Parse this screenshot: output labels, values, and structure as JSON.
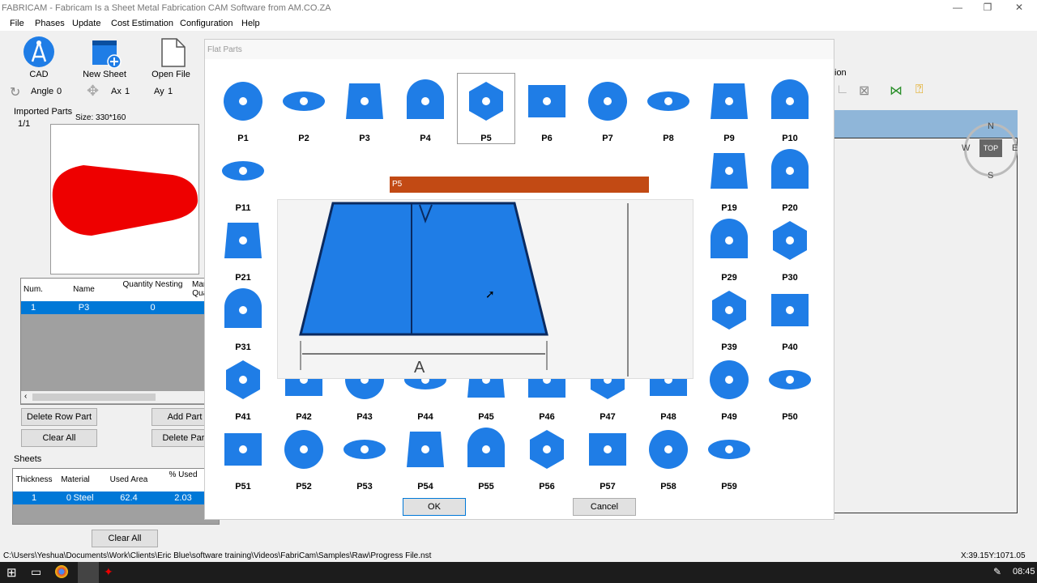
{
  "app": {
    "title": "FABRICAM - Fabricam Is a Sheet Metal Fabrication CAM Software from AM.CO.ZA",
    "minimize": "—",
    "maximize": "❐",
    "close": "✕"
  },
  "menu": [
    "File",
    "Phases",
    "Update",
    "Cost Estimation",
    "Configuration",
    "Help"
  ],
  "toolbar": {
    "cad": "CAD",
    "new_sheet": "New Sheet",
    "open_file": "Open File"
  },
  "controls": {
    "angle_label": "Angle",
    "angle_value": "0",
    "ax_label": "Ax",
    "ax_value": "1",
    "ay_label": "Ay",
    "ay_value": "1"
  },
  "imported": {
    "title": "Imported Parts",
    "page": "1/1",
    "size": "Size: 330*160",
    "columns": [
      "Num.",
      "Name",
      "Quantity Nesting",
      "Manu Quan"
    ],
    "rows": [
      {
        "num": "1",
        "name": "P3",
        "qty": "0",
        "manu": ""
      }
    ],
    "delete_row": "Delete Row Part",
    "add_part": "Add Part",
    "clear_all": "Clear All",
    "delete_part": "Delete Part"
  },
  "sheets": {
    "title": "Sheets",
    "columns": [
      "Thickness",
      "Material",
      "Used Area",
      "% Used"
    ],
    "rows": [
      {
        "thickness": "1",
        "mat_id": "0",
        "material": "Steel",
        "area": "62.4",
        "used": "2.03"
      }
    ],
    "clear_all": "Clear All"
  },
  "viewport": {
    "label_fragment": "ion",
    "compass": {
      "n": "N",
      "s": "S",
      "e": "E",
      "w": "W",
      "top": "TOP"
    }
  },
  "dialog": {
    "title": "Flat Parts",
    "ok": "OK",
    "cancel": "Cancel",
    "preview_title": "P5",
    "preview_dim": "A",
    "row_labels": [
      [
        "P1",
        "P2",
        "P3",
        "P4",
        "P5",
        "P6",
        "P7",
        "P8",
        "P9",
        "P10"
      ],
      [
        "P11",
        "P19",
        "P20"
      ],
      [
        "P21",
        "P29",
        "P30"
      ],
      [
        "P31",
        "P39",
        "P40"
      ],
      [
        "P41",
        "P42",
        "P43",
        "P44",
        "P45",
        "P46",
        "P47",
        "P48",
        "P49",
        "P50"
      ],
      [
        "P51",
        "P52",
        "P53",
        "P54",
        "P55",
        "P56",
        "P57",
        "P58",
        "P59"
      ]
    ]
  },
  "status": {
    "path": "C:\\Users\\Yeshua\\Documents\\Work\\Clients\\Eric Blue\\software training\\Videos\\FabriCam\\Samples\\Raw\\Progress File.nst",
    "coords": "X:39.15Y:1071.05"
  },
  "taskbar": {
    "time": "08:45"
  },
  "colors": {
    "part_blue": "#1f7de6",
    "red_part": "#ee0000",
    "select_blue": "#0078d7",
    "preview_bar": "#c24a14"
  }
}
